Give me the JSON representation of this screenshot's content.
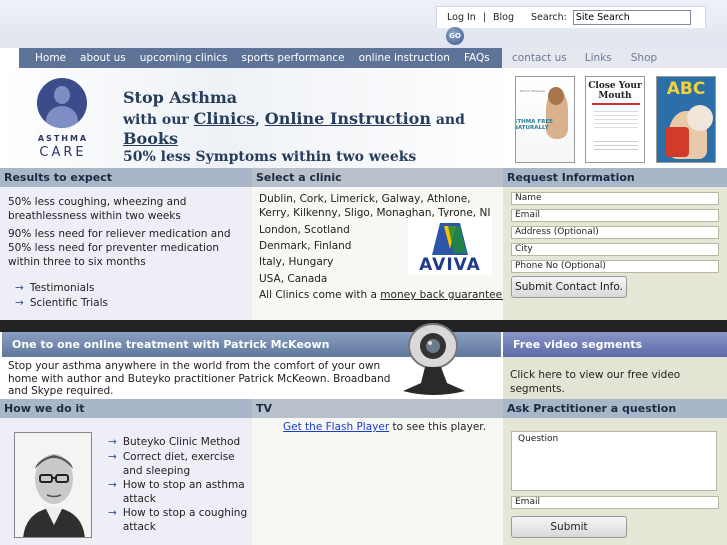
{
  "utility": {
    "login": "Log In",
    "sep": "|",
    "blog": "Blog",
    "search_label": "Search:",
    "search_value": "Site Search",
    "go": "GO"
  },
  "nav": {
    "items": [
      "Home",
      "about us",
      "upcoming clinics",
      "sports performance",
      "online instruction",
      "FAQs"
    ],
    "right": [
      "contact us",
      "Links",
      "Shop"
    ]
  },
  "header": {
    "logo_top": "ASTHMA",
    "logo_bottom": "CARE",
    "line1": "Stop Asthma",
    "line2_prefix": "with our",
    "clinics": "Clinics",
    "comma": ",",
    "online": "Online Instruction",
    "and": "and",
    "books": "Books",
    "line4": "50% less Symptoms within two weeks",
    "book1_title": "ASTHMA FREE NATURALLY",
    "book2_title": "Close Your Mouth",
    "book3_title": "ABC"
  },
  "results": {
    "heading": "Results to expect",
    "p1": "50% less coughing, wheezing and breathlessness within two weeks",
    "p2": "90% less need for reliever medication and 50% less need for preventer medication within three to six months",
    "links": [
      "Testimonials",
      "Scientific Trials"
    ]
  },
  "clinic": {
    "heading": "Select a clinic",
    "cities": "Dublin, Cork, Limerick, Galway, Athlone, Kerry, Kilkenny, Sligo, Monaghan, Tyrone, NI",
    "list": [
      "London, Scotland",
      "Denmark, Finland",
      "Italy, Hungary",
      "USA, Canada"
    ],
    "guarantee_prefix": "All Clinics come with a",
    "guarantee_link": "money back guarantee.",
    "sponsor": "AVIVA"
  },
  "request": {
    "heading": "Request Information",
    "fields": [
      "Name",
      "Email",
      "Address (Optional)",
      "City",
      "Phone No (Optional)"
    ],
    "submit": "Submit Contact Info."
  },
  "online": {
    "heading": "One to one online treatment with Patrick McKeown",
    "body": "Stop your asthma anywhere in the world from the comfort of your own home with author and Buteyko practitioner Patrick McKeown. Broadband and Skype required."
  },
  "video": {
    "heading": "Free video segments",
    "body": "Click here to view our free video segments."
  },
  "how": {
    "heading": "How we do it",
    "items": [
      "Buteyko Clinic Method",
      "Correct diet, exercise and sleeping",
      "How to stop an asthma attack",
      "How to stop a coughing attack"
    ]
  },
  "tv": {
    "heading": "TV",
    "link": "Get the Flash Player",
    "suffix": "to see this player."
  },
  "ask": {
    "heading": "Ask Practitioner a question",
    "question": "Question",
    "email": "Email",
    "submit": "Submit"
  },
  "colors": {
    "nav": "#5d7398",
    "colhead": "#a9b5c8",
    "link_blue": "#3c54a0",
    "aviva_blue": "#1f3a8f"
  }
}
